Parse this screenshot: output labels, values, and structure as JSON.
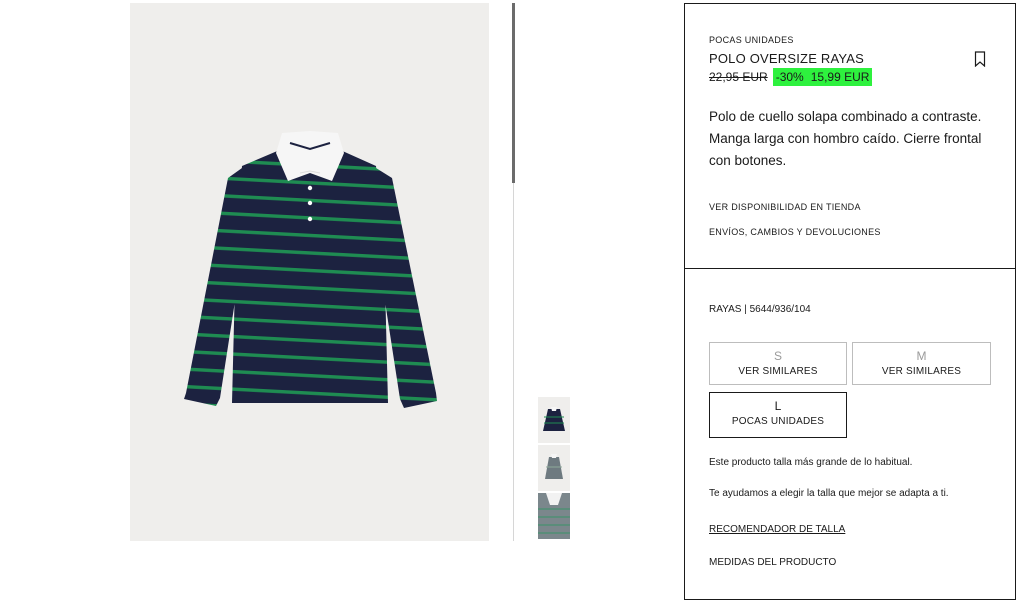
{
  "product": {
    "stock_label": "POCAS UNIDADES",
    "name": "POLO OVERSIZE RAYAS",
    "old_price": "22,95 EUR",
    "discount": "-30%",
    "price": "15,99 EUR",
    "description": "Polo de cuello solapa combinado a contraste. Manga larga con hombro caído. Cierre frontal con botones.",
    "store_link": "VER DISPONIBILIDAD EN TIENDA",
    "shipping_link": "ENVÍOS, CAMBIOS Y DEVOLUCIONES"
  },
  "variant": {
    "reference": "RAYAS | 5644/936/104",
    "sizes": [
      {
        "size": "S",
        "note": "VER SIMILARES"
      },
      {
        "size": "M",
        "note": "VER SIMILARES"
      },
      {
        "size": "L",
        "note": "POCAS UNIDADES"
      }
    ],
    "fit_note": "Este producto talla más grande de lo habitual.",
    "help_text": "Te ayudamos a elegir la talla que mejor se adapta a ti.",
    "recommender_link": "RECOMENDADOR DE TALLA",
    "measures_link": "MEDIDAS DEL PRODUCTO"
  },
  "icons": {
    "bookmark": "bookmark-icon"
  },
  "colors": {
    "discount_highlight": "#2ef13e",
    "shirt_navy": "#1c2240",
    "shirt_green": "#1f8c52",
    "border": "#1a1a1a"
  }
}
